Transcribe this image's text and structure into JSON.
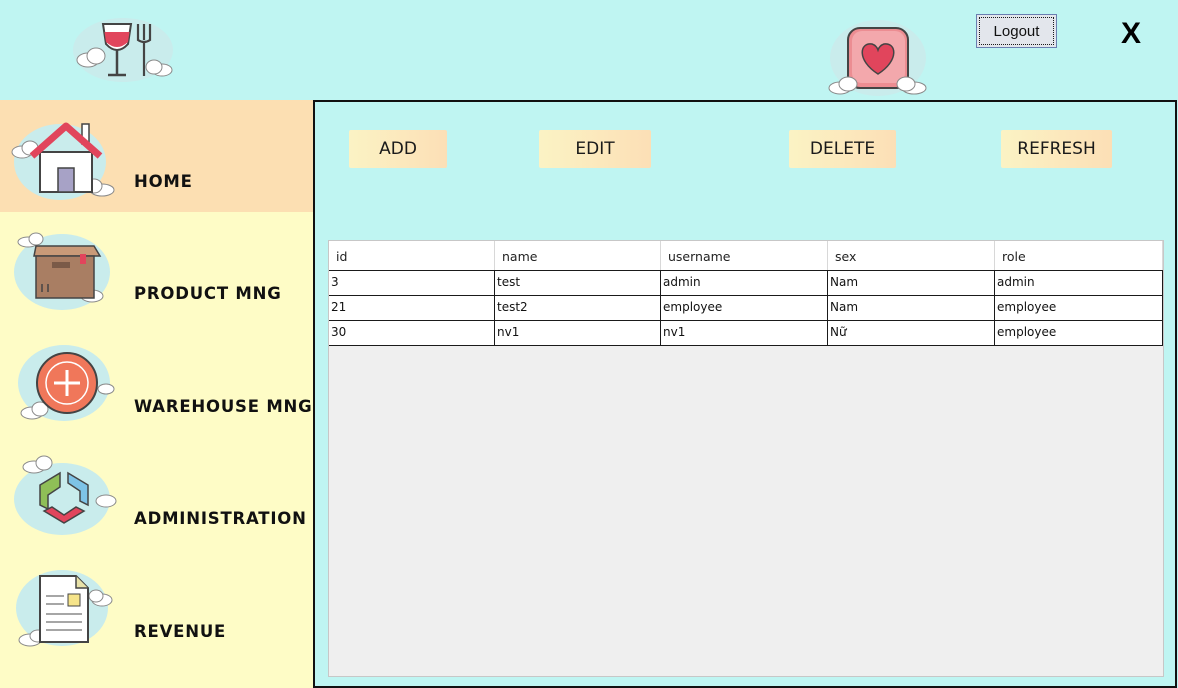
{
  "header": {
    "logout_label": "Logout",
    "close_label": "X"
  },
  "sidebar": {
    "items": [
      {
        "label": "HOME",
        "icon": "house-icon",
        "active": true
      },
      {
        "label": "PRODUCT MNG",
        "icon": "box-icon",
        "active": false
      },
      {
        "label": "WAREHOUSE MNG",
        "icon": "plus-circle-icon",
        "active": false
      },
      {
        "label": "ADMINISTRATION",
        "icon": "hexagon-icon",
        "active": false
      },
      {
        "label": "REVENUE",
        "icon": "document-icon",
        "active": false
      }
    ]
  },
  "toolbar": {
    "add_label": "ADD",
    "edit_label": "EDIT",
    "delete_label": "DELETE",
    "refresh_label": "REFRESH"
  },
  "table": {
    "columns": [
      "id",
      "name",
      "username",
      "sex",
      "role"
    ],
    "rows": [
      [
        "3",
        "test",
        "admin",
        "Nam",
        "admin"
      ],
      [
        "21",
        "test2",
        "employee",
        "Nam",
        "employee"
      ],
      [
        "30",
        "nv1",
        "nv1",
        "Nữ",
        "employee"
      ]
    ]
  },
  "colors": {
    "background": "#bff5f2",
    "sidebar": "#fefcc6",
    "sidebar_active": "#fcdfb2",
    "button": "#fcdfb6"
  }
}
